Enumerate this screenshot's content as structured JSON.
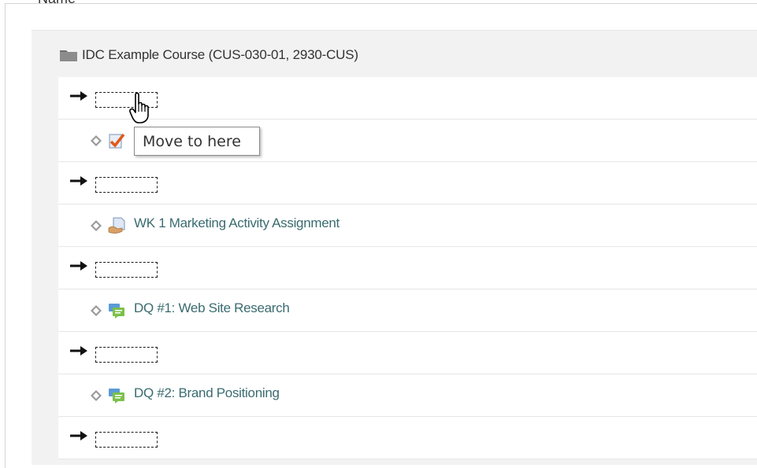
{
  "header": {
    "column_label": "Name"
  },
  "course": {
    "title": "IDC Example Course (CUS-030-01, 2930-CUS)",
    "icon": "folder-icon"
  },
  "rows": [
    {
      "kind": "slot"
    },
    {
      "kind": "activity",
      "icon": "quiz-icon",
      "label": ""
    },
    {
      "kind": "slot"
    },
    {
      "kind": "activity",
      "icon": "assignment-icon",
      "label": "WK 1 Marketing Activity Assignment"
    },
    {
      "kind": "slot"
    },
    {
      "kind": "activity",
      "icon": "forum-icon",
      "label": "DQ #1: Web Site Research"
    },
    {
      "kind": "slot"
    },
    {
      "kind": "activity",
      "icon": "forum-icon",
      "label": "DQ #2: Brand Positioning"
    },
    {
      "kind": "slot"
    }
  ],
  "tooltip": {
    "text": "Move to here"
  },
  "colors": {
    "link": "#3a6b70",
    "panel": "#f2f2f2",
    "divider": "#e6e6e6"
  }
}
